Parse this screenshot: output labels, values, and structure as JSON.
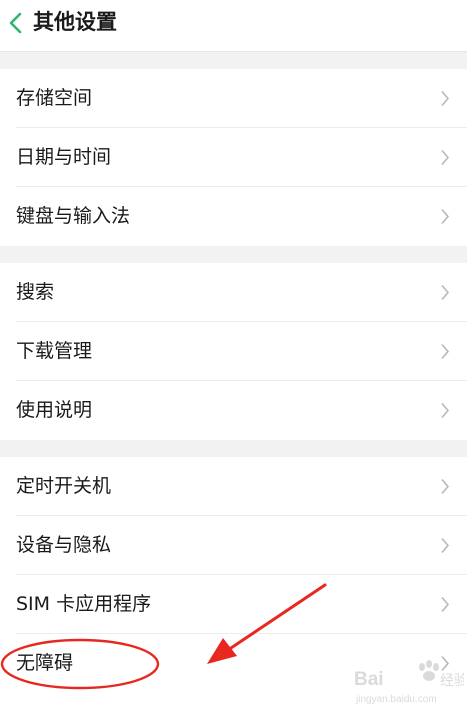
{
  "header": {
    "title": "其他设置",
    "back_icon": "chevron-left-icon",
    "accent_color": "#2fb56f"
  },
  "groups": [
    {
      "items": [
        {
          "label": "存储空间"
        },
        {
          "label": "日期与时间"
        },
        {
          "label": "键盘与输入法"
        }
      ]
    },
    {
      "items": [
        {
          "label": "搜索"
        },
        {
          "label": "下载管理"
        },
        {
          "label": "使用说明"
        }
      ]
    },
    {
      "items": [
        {
          "label": "定时开关机"
        },
        {
          "label": "设备与隐私"
        },
        {
          "label": "SIM 卡应用程序"
        },
        {
          "label": "无障碍"
        }
      ]
    }
  ],
  "row_icon": "chevron-right-icon",
  "annotation": {
    "color": "#e8281e",
    "highlighted_item": "无障碍"
  },
  "watermark": {
    "brand": "Baidu经验",
    "url": "jingyan.baidu.com"
  }
}
